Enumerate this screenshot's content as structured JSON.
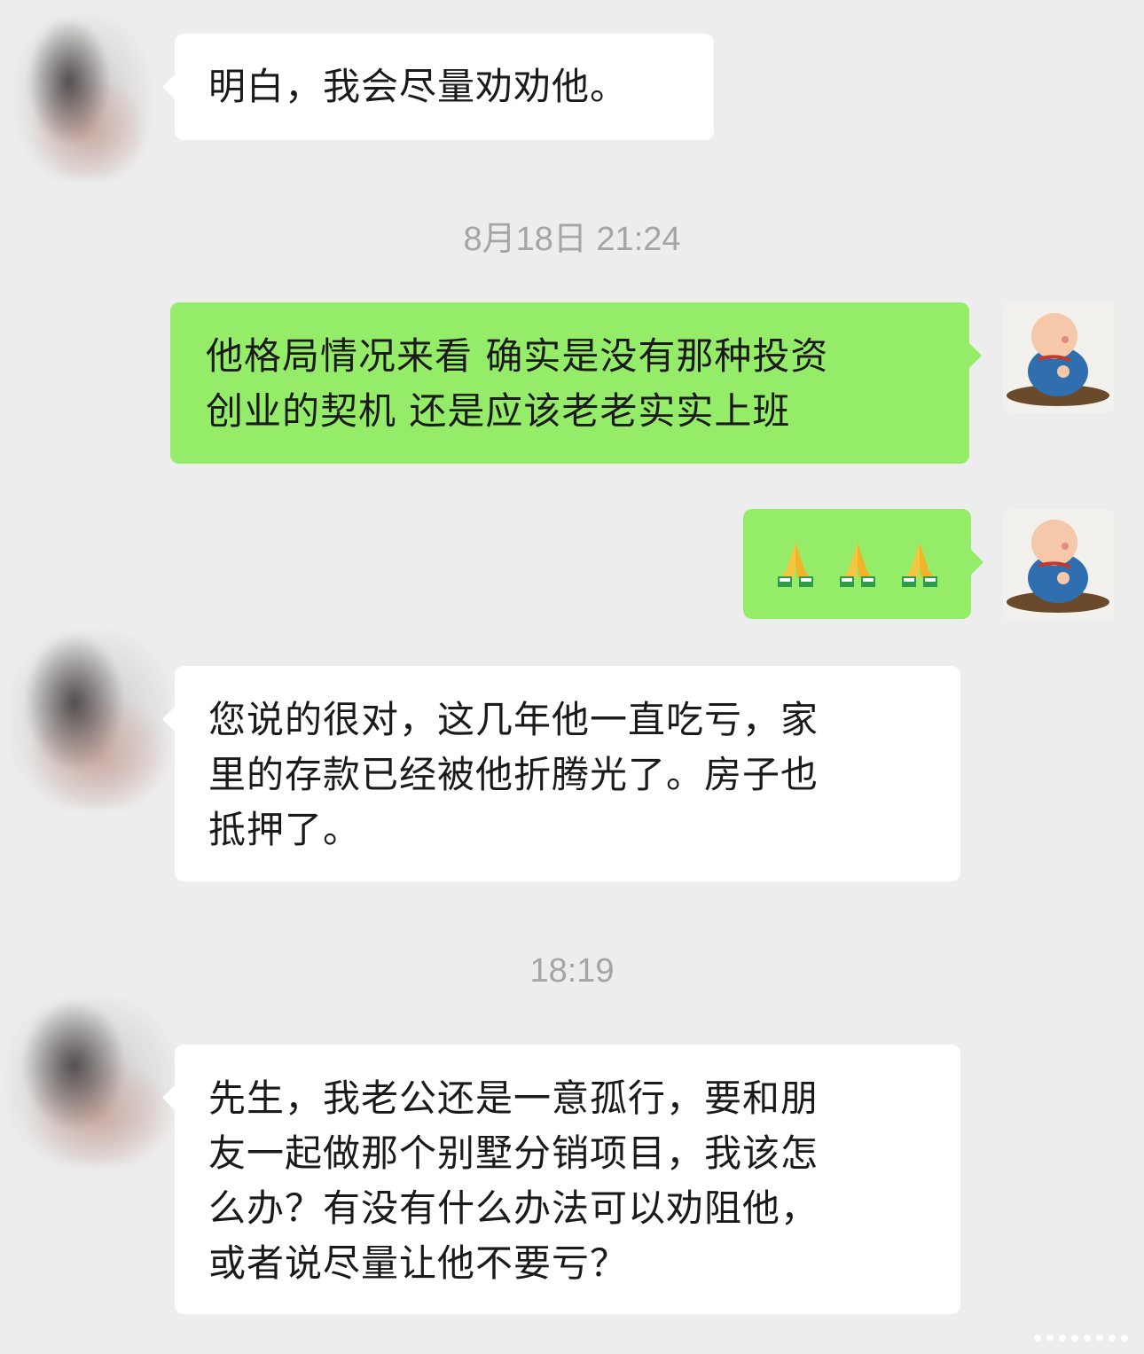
{
  "messages": [
    {
      "side": "in",
      "text": "明白，我会尽量劝劝他。"
    },
    {
      "timestamp": "8月18日 21:24"
    },
    {
      "side": "out",
      "lines": [
        "他格局情况来看 确实是没有那种投资",
        "创业的契机 还是应该老老实实上班"
      ]
    },
    {
      "side": "out",
      "emoji": [
        "folded-hands",
        "folded-hands",
        "folded-hands"
      ]
    },
    {
      "side": "in",
      "lines": [
        "您说的很对，这几年他一直吃亏，家",
        "里的存款已经被他折腾光了。房子也",
        "抵押了。"
      ]
    },
    {
      "timestamp": "18:19"
    },
    {
      "side": "in",
      "lines": [
        "先生，我老公还是一意孤行，要和朋",
        "友一起做那个别墅分销项目，我该怎",
        "么办？有没有什么办法可以劝阻他，",
        "或者说尽量让他不要亏？"
      ]
    }
  ],
  "colors": {
    "background": "#ededed",
    "incoming": "#ffffff",
    "outgoing": "#95ec69",
    "timestamp": "#a5a5a5"
  }
}
